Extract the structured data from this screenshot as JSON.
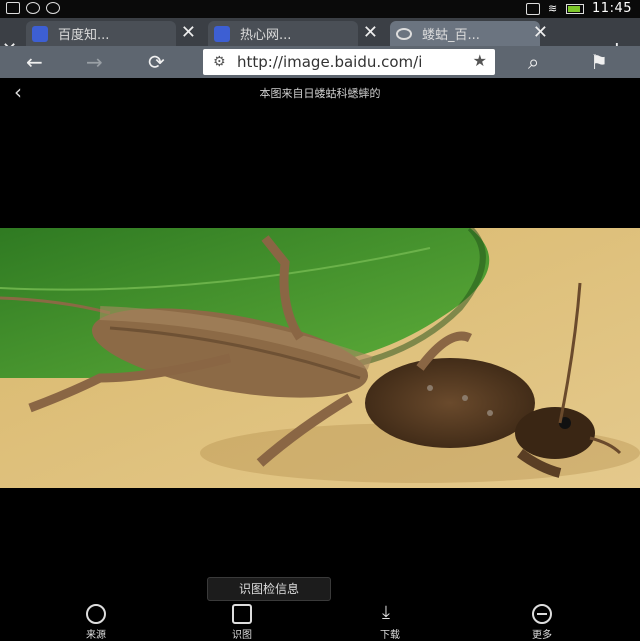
{
  "status_bar": {
    "time": "11:45"
  },
  "tabs": [
    {
      "label": "百度知..."
    },
    {
      "label": "热心网..."
    },
    {
      "label": "蝼蛄_百..."
    }
  ],
  "nav": {
    "url": "http://image.baidu.com/i"
  },
  "viewer": {
    "title": "本图来自日蝼蛄科蟋蟀的",
    "identify_label": "识图检信息"
  },
  "bottom_bar": [
    {
      "label": "来源",
      "icon": "compass-icon"
    },
    {
      "label": "识图",
      "icon": "scan-icon"
    },
    {
      "label": "下载",
      "icon": "download-icon"
    },
    {
      "label": "更多",
      "icon": "more-icon"
    }
  ],
  "colors": {
    "tab_active": "#6b7480",
    "nav_bar": "#5e6670",
    "background": "#000000",
    "leaf_green": "#3f8a2a",
    "surface_tan": "#d2b26c"
  }
}
